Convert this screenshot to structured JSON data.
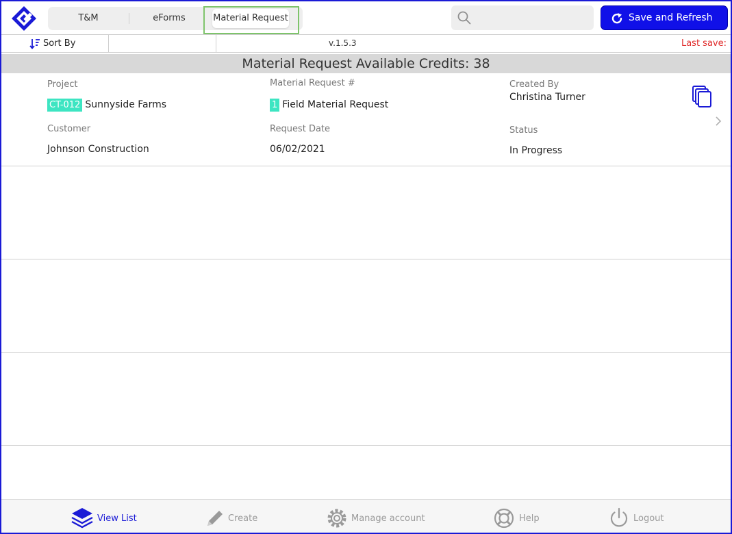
{
  "tabs": [
    {
      "label": "T&M"
    },
    {
      "label": "eForms"
    },
    {
      "label": "Material Request"
    }
  ],
  "search": {
    "placeholder": ""
  },
  "save_button": {
    "label": "Save and Refresh"
  },
  "sortbar": {
    "sort_label": "Sort By",
    "version": "v.1.5.3",
    "last_save": "Last save:"
  },
  "credits_header": "Material Request Available Credits: 38",
  "record": {
    "project_label": "Project",
    "project_code": "CT-012",
    "project_name": "Sunnyside Farms",
    "mr_label": "Material Request #",
    "mr_number": "1",
    "mr_name": "Field Material Request",
    "created_by_label": "Created By",
    "created_by": "Christina Turner",
    "customer_label": "Customer",
    "customer": "Johnson Construction",
    "request_date_label": "Request Date",
    "request_date": "06/02/2021",
    "status_label": "Status",
    "status": "In Progress"
  },
  "bottom_nav": [
    {
      "label": "View List",
      "icon": "layers-icon",
      "active": true
    },
    {
      "label": "Create",
      "icon": "pencil-icon",
      "active": false
    },
    {
      "label": "Manage account",
      "icon": "gear-icon",
      "active": false
    },
    {
      "label": "Help",
      "icon": "lifebuoy-icon",
      "active": false
    },
    {
      "label": "Logout",
      "icon": "power-icon",
      "active": false
    }
  ],
  "colors": {
    "accent": "#1010e8",
    "tag": "#3de5c2",
    "last_save": "#e02a2a",
    "highlight": "#7ec46b",
    "header_bg": "#d8d8d8"
  }
}
